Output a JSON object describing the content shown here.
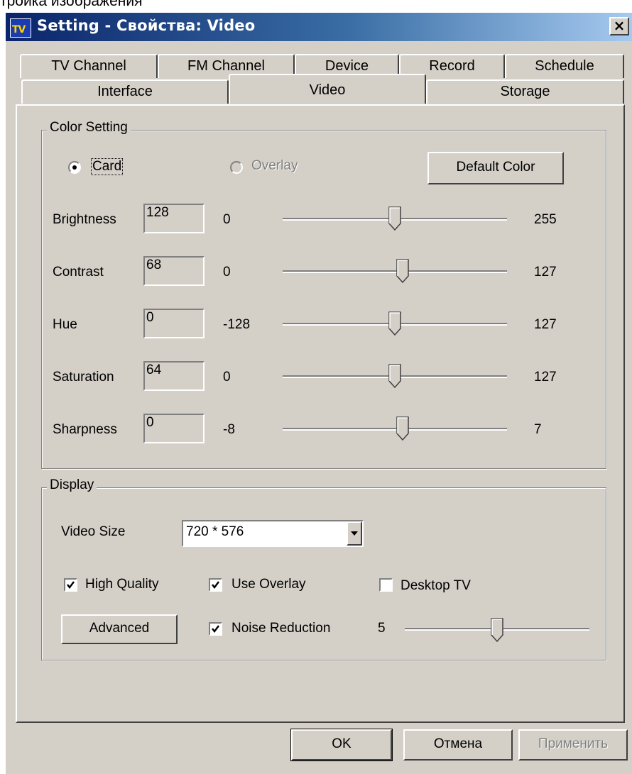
{
  "page_caption": "тройка изображения",
  "window": {
    "title": "Setting - Свойства: Video",
    "close": "×",
    "icon_text": "TV"
  },
  "tabs": {
    "row1": [
      "TV Channel",
      "FM Channel",
      "Device",
      "Record",
      "Schedule"
    ],
    "row2": [
      "Interface",
      "Video",
      "Storage"
    ],
    "active": "Video"
  },
  "color_setting": {
    "label": "Color Setting",
    "card_label": "Card",
    "overlay_label": "Overlay",
    "source_selected": "Card",
    "default_button": "Default Color",
    "sliders": [
      {
        "name": "Brightness",
        "value": "128",
        "min": "0",
        "max": "255",
        "level": 0.5
      },
      {
        "name": "Contrast",
        "value": "68",
        "min": "0",
        "max": "127",
        "level": 0.535
      },
      {
        "name": "Hue",
        "value": "0",
        "min": "-128",
        "max": "127",
        "level": 0.5
      },
      {
        "name": "Saturation",
        "value": "64",
        "min": "0",
        "max": "127",
        "level": 0.5
      },
      {
        "name": "Sharpness",
        "value": "0",
        "min": "-8",
        "max": "7",
        "level": 0.535
      }
    ]
  },
  "display": {
    "label": "Display",
    "video_size_label": "Video Size",
    "video_size_value": "720 * 576",
    "high_quality": {
      "label": "High Quality",
      "checked": true
    },
    "use_overlay": {
      "label": "Use Overlay",
      "checked": true
    },
    "desktop_tv": {
      "label": "Desktop TV",
      "checked": false
    },
    "advanced_button": "Advanced",
    "noise_reduction": {
      "label": "Noise Reduction",
      "checked": true,
      "value": "5",
      "level": 0.5
    }
  },
  "footer": {
    "ok": "OK",
    "cancel": "Отмена",
    "apply": "Применить"
  },
  "colors": {
    "face": "#d4d0c8",
    "title_start": "#0a246a",
    "title_end": "#a6caf0",
    "disabled_text": "#808080"
  }
}
